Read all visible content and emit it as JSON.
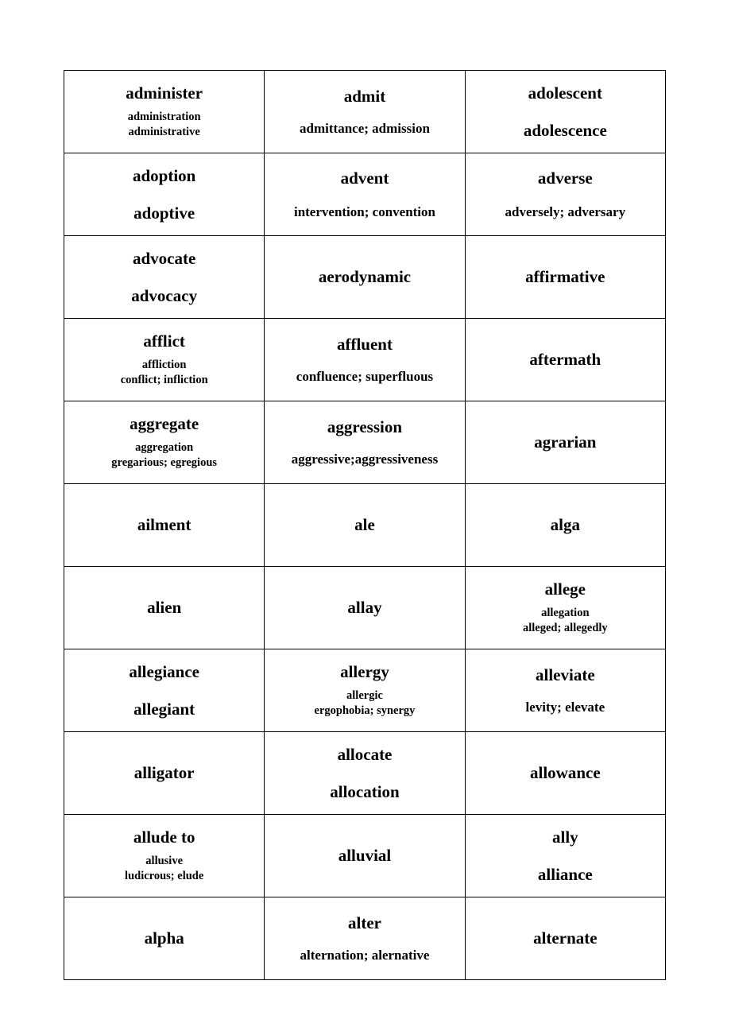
{
  "document": {
    "kind": "vocabulary-word-family-table",
    "columns": 3,
    "rows": 11,
    "background_color": "#ffffff",
    "text_color": "#000000",
    "border_color": "#000000"
  },
  "table": {
    "rows": [
      [
        {
          "headword": "administer",
          "lines": [
            {
              "text": "administration",
              "size": "sm"
            },
            {
              "text": "administrative",
              "size": "sm"
            }
          ],
          "spacing": "tight"
        },
        {
          "headword": "admit",
          "lines": [
            {
              "text": "admittance; admission",
              "size": "md"
            }
          ],
          "spacing": "mid"
        },
        {
          "headword": "adolescent",
          "lines": [
            {
              "text": "adolescence",
              "size": "lg"
            }
          ],
          "spacing": "gap-wide"
        }
      ],
      [
        {
          "headword": "adoption",
          "lines": [
            {
              "text": "adoptive",
              "size": "lg"
            }
          ],
          "spacing": "gap-wide"
        },
        {
          "headword": "advent",
          "lines": [
            {
              "text": "intervention; convention",
              "size": "md"
            }
          ],
          "spacing": "gap-wide"
        },
        {
          "headword": "adverse",
          "lines": [
            {
              "text": "adversely; adversary",
              "size": "md"
            }
          ],
          "spacing": "gap-wide"
        }
      ],
      [
        {
          "headword": "advocate",
          "lines": [
            {
              "text": "advocacy",
              "size": "lg"
            }
          ],
          "spacing": "gap-wide"
        },
        {
          "headword": "aerodynamic",
          "lines": [],
          "spacing": "mid"
        },
        {
          "headword": "affirmative",
          "lines": [],
          "spacing": "mid"
        }
      ],
      [
        {
          "headword": "afflict",
          "lines": [
            {
              "text": "affliction",
              "size": "sm"
            },
            {
              "text": "conflict; infliction",
              "size": "sm"
            }
          ],
          "spacing": "tight"
        },
        {
          "headword": "affluent",
          "lines": [
            {
              "text": "confluence; superfluous",
              "size": "md"
            }
          ],
          "spacing": "mid"
        },
        {
          "headword": "aftermath",
          "lines": [],
          "spacing": "mid"
        }
      ],
      [
        {
          "headword": "aggregate",
          "lines": [
            {
              "text": "aggregation",
              "size": "sm"
            },
            {
              "text": "gregarious; egregious",
              "size": "sm"
            }
          ],
          "spacing": "tight"
        },
        {
          "headword": "aggression",
          "lines": [
            {
              "text": "aggressive;aggressiveness",
              "size": "md"
            }
          ],
          "spacing": "mid"
        },
        {
          "headword": "agrarian",
          "lines": [],
          "spacing": "mid"
        }
      ],
      [
        {
          "headword": "ailment",
          "lines": [],
          "spacing": "mid"
        },
        {
          "headword": "ale",
          "lines": [],
          "spacing": "mid"
        },
        {
          "headword": "alga",
          "lines": [],
          "spacing": "mid"
        }
      ],
      [
        {
          "headword": "alien",
          "lines": [],
          "spacing": "mid"
        },
        {
          "headword": "allay",
          "lines": [],
          "spacing": "mid"
        },
        {
          "headword": "allege",
          "lines": [
            {
              "text": "allegation",
              "size": "sm"
            },
            {
              "text": "alleged; allegedly",
              "size": "sm"
            }
          ],
          "spacing": "tight"
        }
      ],
      [
        {
          "headword": "allegiance",
          "lines": [
            {
              "text": "allegiant",
              "size": "lg"
            }
          ],
          "spacing": "gap-wide"
        },
        {
          "headword": "allergy",
          "lines": [
            {
              "text": "allergic",
              "size": "sm"
            },
            {
              "text": "ergophobia; synergy",
              "size": "sm"
            }
          ],
          "spacing": "tight"
        },
        {
          "headword": "alleviate",
          "lines": [
            {
              "text": "levity; elevate",
              "size": "md"
            }
          ],
          "spacing": "mid"
        }
      ],
      [
        {
          "headword": "alligator",
          "lines": [],
          "spacing": "mid"
        },
        {
          "headword": "allocate",
          "lines": [
            {
              "text": "allocation",
              "size": "lg"
            }
          ],
          "spacing": "gap-wide"
        },
        {
          "headword": "allowance",
          "lines": [],
          "spacing": "mid"
        }
      ],
      [
        {
          "headword": "allude to",
          "lines": [
            {
              "text": "allusive",
              "size": "sm"
            },
            {
              "text": "ludicrous; elude",
              "size": "sm"
            }
          ],
          "spacing": "tight"
        },
        {
          "headword": "alluvial",
          "lines": [],
          "spacing": "mid"
        },
        {
          "headword": "ally",
          "lines": [
            {
              "text": "alliance",
              "size": "lg"
            }
          ],
          "spacing": "gap-wide"
        }
      ],
      [
        {
          "headword": "alpha",
          "lines": [],
          "spacing": "mid"
        },
        {
          "headword": "alter",
          "lines": [
            {
              "text": "alternation; alernative",
              "size": "md"
            }
          ],
          "spacing": "mid"
        },
        {
          "headword": "alternate",
          "lines": [],
          "spacing": "mid"
        }
      ]
    ]
  }
}
